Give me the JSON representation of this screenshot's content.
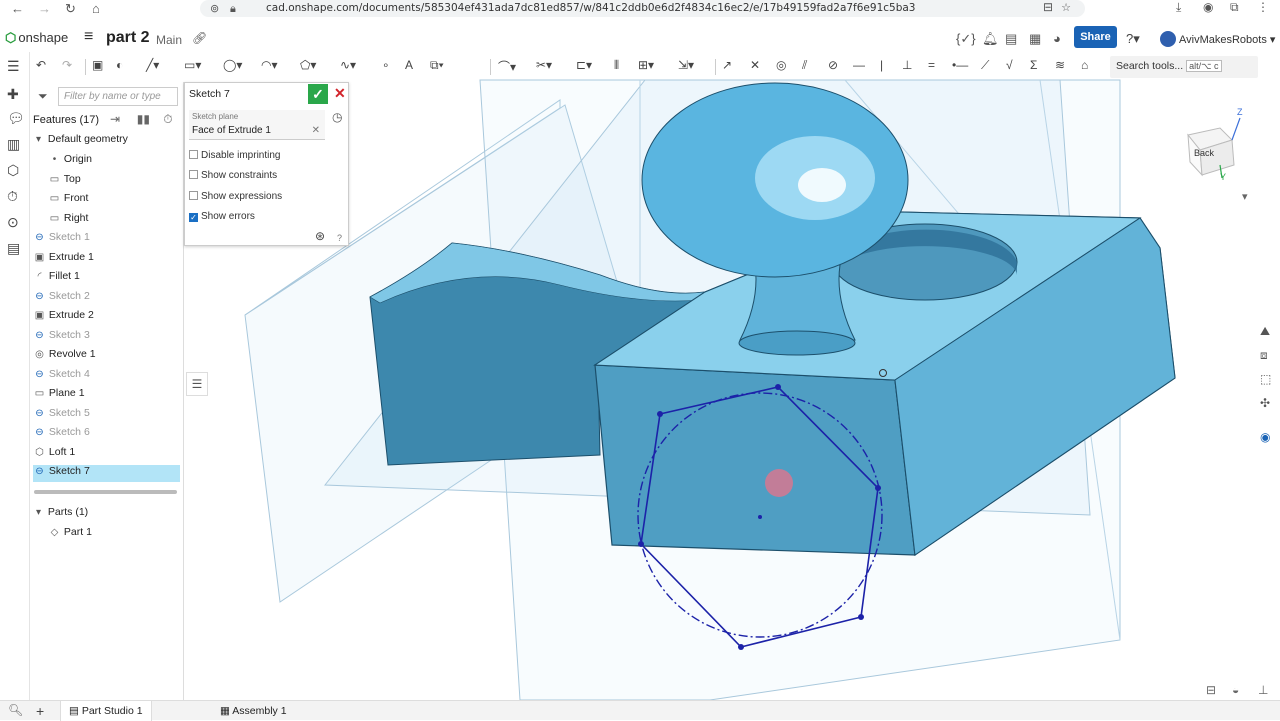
{
  "browser": {
    "url": "cad.onshape.com/documents/585304ef431ada7dc81ed857/w/841c2ddb0e6d2f4834c16ec2/e/17b49159fad2a7f6e91c5ba3"
  },
  "app": {
    "logo": "onshape",
    "doc_title": "part 2",
    "branch": "Main",
    "share": "Share",
    "user": "AvivMakesRobots",
    "accent": "#1a63b5"
  },
  "toolbar": {
    "search_placeholder": "Search tools...",
    "search_shortcut": "alt/⌥ c"
  },
  "features": {
    "filter_placeholder": "Filter by name or type",
    "header": "Features (17)",
    "default_geometry": "Default geometry",
    "items": [
      {
        "label": "Origin",
        "icon": "origin-icon",
        "state": "normal"
      },
      {
        "label": "Top",
        "icon": "plane-icon",
        "state": "normal"
      },
      {
        "label": "Front",
        "icon": "plane-icon",
        "state": "normal"
      },
      {
        "label": "Right",
        "icon": "plane-icon",
        "state": "normal"
      },
      {
        "label": "Sketch 1",
        "icon": "sketch-icon",
        "state": "hidden"
      },
      {
        "label": "Extrude 1",
        "icon": "extrude-icon",
        "state": "normal"
      },
      {
        "label": "Fillet 1",
        "icon": "fillet-icon",
        "state": "normal"
      },
      {
        "label": "Sketch 2",
        "icon": "sketch-icon",
        "state": "hidden"
      },
      {
        "label": "Extrude 2",
        "icon": "extrude-icon",
        "state": "normal"
      },
      {
        "label": "Sketch 3",
        "icon": "sketch-icon",
        "state": "hidden"
      },
      {
        "label": "Revolve 1",
        "icon": "revolve-icon",
        "state": "normal"
      },
      {
        "label": "Sketch 4",
        "icon": "sketch-icon",
        "state": "hidden"
      },
      {
        "label": "Plane 1",
        "icon": "plane-icon",
        "state": "normal"
      },
      {
        "label": "Sketch 5",
        "icon": "sketch-icon",
        "state": "hidden"
      },
      {
        "label": "Sketch 6",
        "icon": "sketch-icon",
        "state": "hidden"
      },
      {
        "label": "Loft 1",
        "icon": "loft-icon",
        "state": "normal"
      },
      {
        "label": "Sketch 7",
        "icon": "sketch-icon",
        "state": "selected"
      }
    ],
    "parts_header": "Parts (1)",
    "parts": [
      "Part 1"
    ]
  },
  "sketch_dialog": {
    "title": "Sketch 7",
    "plane_label": "Sketch plane",
    "plane_value": "Face of Extrude 1",
    "options": [
      {
        "label": "Disable imprinting",
        "checked": false
      },
      {
        "label": "Show constraints",
        "checked": false
      },
      {
        "label": "Show expressions",
        "checked": false
      },
      {
        "label": "Show errors",
        "checked": true
      }
    ]
  },
  "viewport": {
    "view_cube_face": "Back",
    "axis_z": "Z",
    "axis_y": "Y",
    "sketch_color": "#1c22a8",
    "part_color": "#5bb8dc"
  },
  "tabs": [
    {
      "label": "Part Studio 1",
      "active": true
    },
    {
      "label": "Assembly 1",
      "active": false
    }
  ]
}
